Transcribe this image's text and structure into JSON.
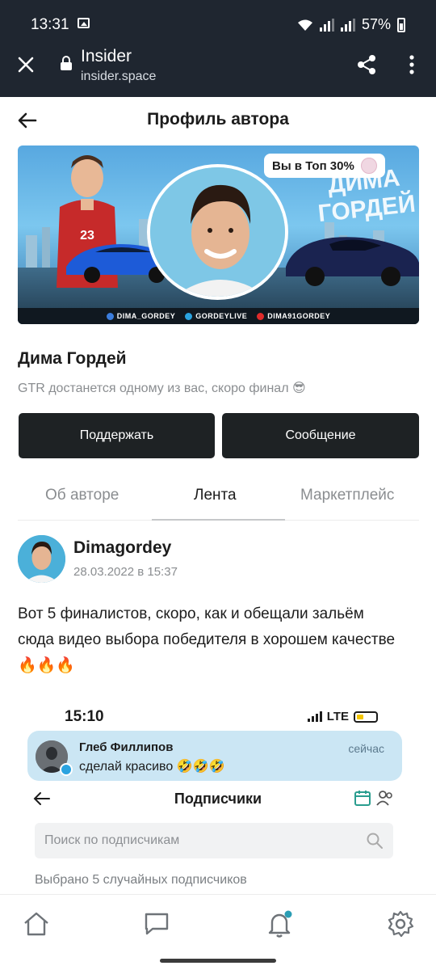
{
  "status_bar": {
    "time": "13:31",
    "battery": "57%"
  },
  "browser": {
    "title": "Insider",
    "url": "insider.space"
  },
  "header": {
    "title": "Профиль автора"
  },
  "banner": {
    "badge": "Вы в Топ 30%",
    "big_text_line1": "ДИМА",
    "big_text_line2": "ГОРДЕЙ",
    "social_1": "DIMA_GORDEY",
    "social_2": "GORDEYLIVE",
    "social_3": "DIMA91GORDEY"
  },
  "profile": {
    "name": "Дима Гордей",
    "description": "GTR достанется одному из вас, скоро финал 😎",
    "support_label": "Поддержать",
    "message_label": "Сообщение"
  },
  "tabs": [
    {
      "label": "Об авторе",
      "active": false
    },
    {
      "label": "Лента",
      "active": true
    },
    {
      "label": "Маркетплейс",
      "active": false
    }
  ],
  "post": {
    "author": "Dimagordey",
    "date": "28.03.2022 в 15:37",
    "text": "Вот 5 финалистов, скоро, как и обещали зальём сюда видео выбора победителя в хорошем качестве",
    "emoji": "🔥🔥🔥",
    "embed": {
      "time": "15:10",
      "network": "LTE",
      "notification": {
        "name": "Глеб Филлипов",
        "message": "сделай красиво 🤣🤣🤣",
        "time": "сейчас"
      },
      "title": "Подписчики",
      "search_placeholder": "Поиск по подписчикам",
      "caption": "Выбрано 5 случайных подписчиков"
    }
  },
  "colors": {
    "dark": "#1e2224",
    "chrome": "#1f2630",
    "muted": "#8a8d90",
    "accent_dot": "#2a9db4"
  },
  "bottom_nav": [
    "home-icon",
    "chat-icon",
    "bell-icon",
    "gear-icon"
  ]
}
